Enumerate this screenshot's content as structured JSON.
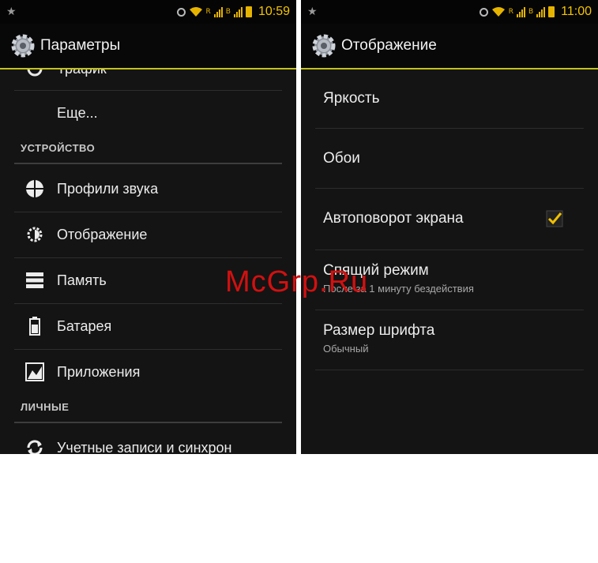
{
  "left_screen": {
    "status": {
      "time": "10:59",
      "net1": "R",
      "net2": "B"
    },
    "title": "Параметры",
    "partial_top_item": "Трафик",
    "more_item": "Еще...",
    "section_device": "УСТРОЙСТВО",
    "device_items": [
      {
        "label": "Профили звука",
        "icon": "sound-profiles-icon"
      },
      {
        "label": "Отображение",
        "icon": "display-icon"
      },
      {
        "label": "Память",
        "icon": "storage-icon"
      },
      {
        "label": "Батарея",
        "icon": "battery-icon"
      },
      {
        "label": "Приложения",
        "icon": "apps-icon"
      }
    ],
    "section_personal": "ЛИЧНЫЕ",
    "personal_items": [
      {
        "label": "Учетные записи и синхрон",
        "icon": "sync-icon"
      }
    ]
  },
  "right_screen": {
    "status": {
      "time": "11:00",
      "net1": "R",
      "net2": "B"
    },
    "title": "Отображение",
    "items": [
      {
        "label": "Яркость"
      },
      {
        "label": "Обои"
      },
      {
        "label": "Автоповорот экрана",
        "checked": true
      },
      {
        "label": "Спящий режим",
        "sub": "После за 1 минуту бездействия"
      },
      {
        "label": "Размер шрифта",
        "sub": "Обычный"
      }
    ]
  },
  "watermark": "McGrp.Ru",
  "colors": {
    "accent": "#c2c21a",
    "status": "#f3c400",
    "watermark": "#d21010"
  }
}
